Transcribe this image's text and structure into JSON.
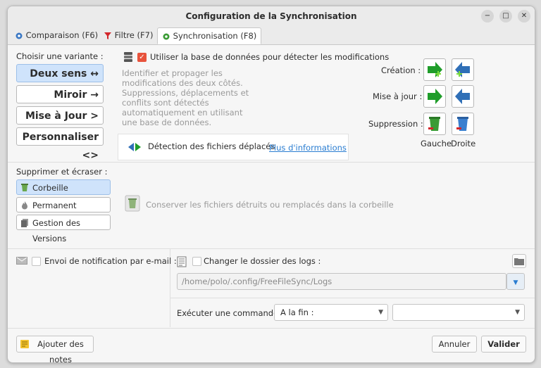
{
  "window": {
    "title": "Configuration de la Synchronisation"
  },
  "tabs": [
    {
      "label": "Comparaison (F6)",
      "icon": "gear-blue-icon"
    },
    {
      "label": "Filtre (F7)",
      "icon": "filter-icon"
    },
    {
      "label": "Synchronisation (F8)",
      "icon": "gear-green-icon",
      "active": true
    }
  ],
  "variant": {
    "heading": "Choisir une variante :",
    "options": [
      {
        "label": "Deux sens",
        "symbol": "↔",
        "selected": true
      },
      {
        "label": "Miroir",
        "symbol": "→",
        "selected": false
      },
      {
        "label": "Mise à Jour",
        "symbol": ">",
        "selected": false
      },
      {
        "label": "Personnaliser",
        "symbol": "<>",
        "selected": false
      }
    ]
  },
  "database": {
    "checkbox_label": "Utiliser la base de données pour détecter les modifications",
    "checked": true,
    "description": "Identifier et propager les modifications des deux côtés. Suppressions, déplacements et conflits sont détectés automatiquement en utilisant une base de données."
  },
  "moved_files": {
    "label": "Détection des fichiers déplacés",
    "link": "Plus d'informations"
  },
  "actions": {
    "creation_label": "Création :",
    "update_label": "Mise à jour :",
    "delete_label": "Suppression :",
    "left_label": "Gauche",
    "right_label": "Droite"
  },
  "delete": {
    "heading": "Supprimer et écraser :",
    "options": [
      {
        "label": "Corbeille",
        "selected": true
      },
      {
        "label": "Permanent",
        "selected": false
      },
      {
        "label": "Gestion des Versions",
        "selected": false
      }
    ],
    "note": "Conserver les fichiers détruits ou remplacés dans la corbeille"
  },
  "notification": {
    "label": "Envoi de notification par e-mail :",
    "checked": false
  },
  "logs": {
    "label": "Changer le dossier des logs :",
    "checked": false,
    "path": "/home/polo/.config/FreeFileSync/Logs"
  },
  "command": {
    "label": "Exécuter une commande :",
    "when": "A la fin :",
    "value": ""
  },
  "footer": {
    "notes_button": "Ajouter des notes",
    "cancel_button": "Annuler",
    "ok_button": "Valider"
  },
  "colors": {
    "accent": "#e8533c",
    "selection": "#cfe3fb",
    "link": "#2a7dd1",
    "green_arrow": "#1f9d2a",
    "blue_arrow": "#2f6fb7"
  }
}
